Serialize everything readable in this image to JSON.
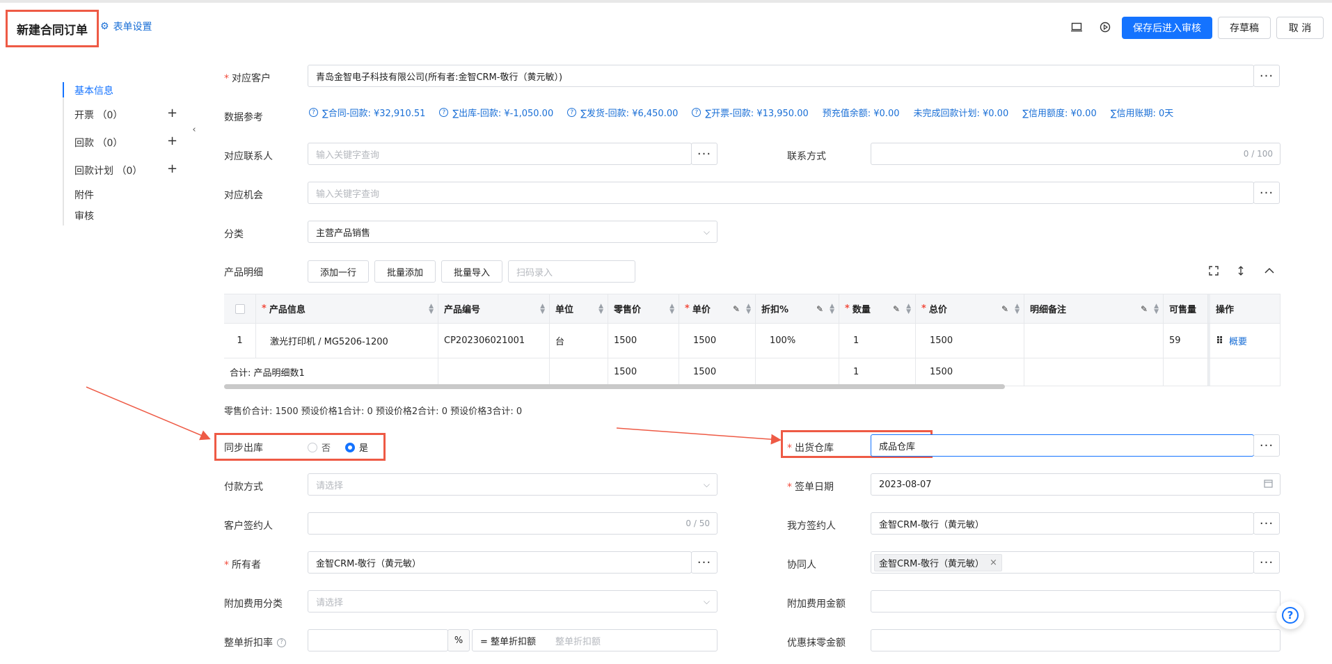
{
  "header": {
    "title": "新建合同订单",
    "form_settings": "表单设置",
    "save_review": "保存后进入审核",
    "save_draft": "存草稿",
    "cancel": "取 消"
  },
  "nav": {
    "items": [
      {
        "label": "基本信息"
      },
      {
        "label": "开票 （0）"
      },
      {
        "label": "回款 （0）"
      },
      {
        "label": "回款计划 （0）"
      },
      {
        "label": "附件"
      },
      {
        "label": "审核"
      }
    ]
  },
  "form": {
    "customer_label": "对应客户",
    "customer_value": "青岛金智电子科技有限公司(所有者:金智CRM-敬行（黄元敏）)",
    "ref_label": "数据参考",
    "refs": [
      "∑合同-回款: ¥32,910.51",
      "∑出库-回款: ¥-1,050.00",
      "∑发货-回款: ¥6,450.00",
      "∑开票-回款: ¥13,950.00"
    ],
    "refs_plain": [
      "预充值余额: ¥0.00",
      "未完成回款计划: ¥0.00",
      "∑信用额度: ¥0.00",
      "∑信用账期: 0天"
    ],
    "contact_label": "对应联系人",
    "contact_placeholder": "输入关键字查询",
    "contact_way_label": "联系方式",
    "contact_way_counter": "0 / 100",
    "opportunity_label": "对应机会",
    "opportunity_placeholder": "输入关键字查询",
    "category_label": "分类",
    "category_value": "主营产品销售",
    "product_detail_label": "产品明细",
    "btn_add_row": "添加一行",
    "btn_batch_add": "批量添加",
    "btn_batch_import": "批量导入",
    "scan_placeholder": "扫码录入",
    "summary": "零售价合计: 1500  预设价格1合计: 0  预设价格2合计: 0  预设价格3合计: 0",
    "sync_label": "同步出库",
    "sync_no": "否",
    "sync_yes": "是",
    "warehouse_label": "出货仓库",
    "warehouse_value": "成品仓库",
    "payment_label": "付款方式",
    "payment_placeholder": "请选择",
    "sign_date_label": "签单日期",
    "sign_date_value": "2023-08-07",
    "customer_signer_label": "客户签约人",
    "customer_signer_counter": "0 / 50",
    "our_signer_label": "我方签约人",
    "our_signer_value": "金智CRM-敬行（黄元敏）",
    "owner_label": "所有者",
    "owner_value": "金智CRM-敬行（黄元敏）",
    "collaborator_label": "协同人",
    "collaborator_tag": "金智CRM-敬行（黄元敏）",
    "extra_fee_cat_label": "附加费用分类",
    "extra_fee_cat_placeholder": "请选择",
    "extra_fee_amt_label": "附加费用金额",
    "discount_rate_label": "整单折扣率",
    "discount_pct": "%",
    "discount_amount_label": "= 整单折扣额",
    "discount_amount_placeholder": "整单折扣额",
    "rounding_label": "优惠抹零金额"
  },
  "table": {
    "headers": [
      "产品信息",
      "产品编号",
      "单位",
      "零售价",
      "单价",
      "折扣%",
      "数量",
      "总价",
      "明细备注",
      "可售量",
      "操作"
    ],
    "rows": [
      {
        "idx": "1",
        "product": "激光打印机 / MG5206-1200",
        "code": "CP202306021001",
        "unit": "台",
        "retail": "1500",
        "price": "1500",
        "discount": "100%",
        "qty": "1",
        "total": "1500",
        "remark": "",
        "available": "59",
        "action": "概要"
      }
    ],
    "total_row": {
      "label": "合计: 产品明细数1",
      "retail": "1500",
      "price": "1500",
      "qty": "1",
      "total": "1500"
    }
  }
}
